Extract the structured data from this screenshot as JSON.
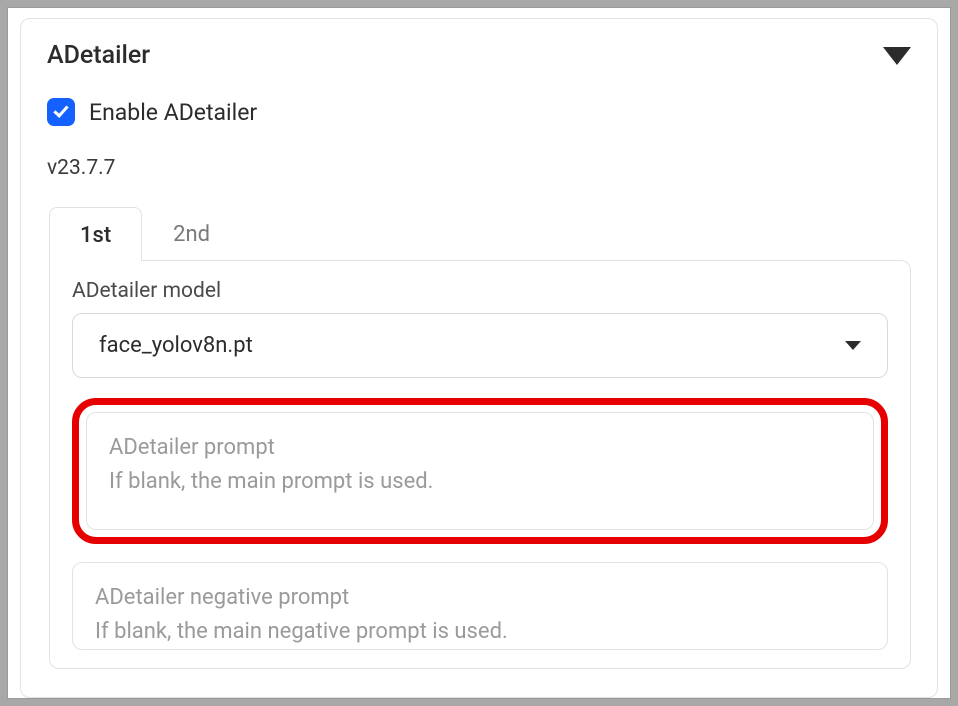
{
  "panel": {
    "title": "ADetailer",
    "enable_label": "Enable ADetailer",
    "enabled": true,
    "version": "v23.7.7"
  },
  "tabs": {
    "items": [
      "1st",
      "2nd"
    ],
    "active": 0
  },
  "model": {
    "label": "ADetailer model",
    "selected": "face_yolov8n.pt"
  },
  "prompt": {
    "placeholder": "ADetailer prompt\nIf blank, the main prompt is used.",
    "value": ""
  },
  "negative_prompt": {
    "placeholder": "ADetailer negative prompt\nIf blank, the main negative prompt is used.",
    "value": ""
  },
  "annotations": {
    "highlight_prompt": true
  }
}
